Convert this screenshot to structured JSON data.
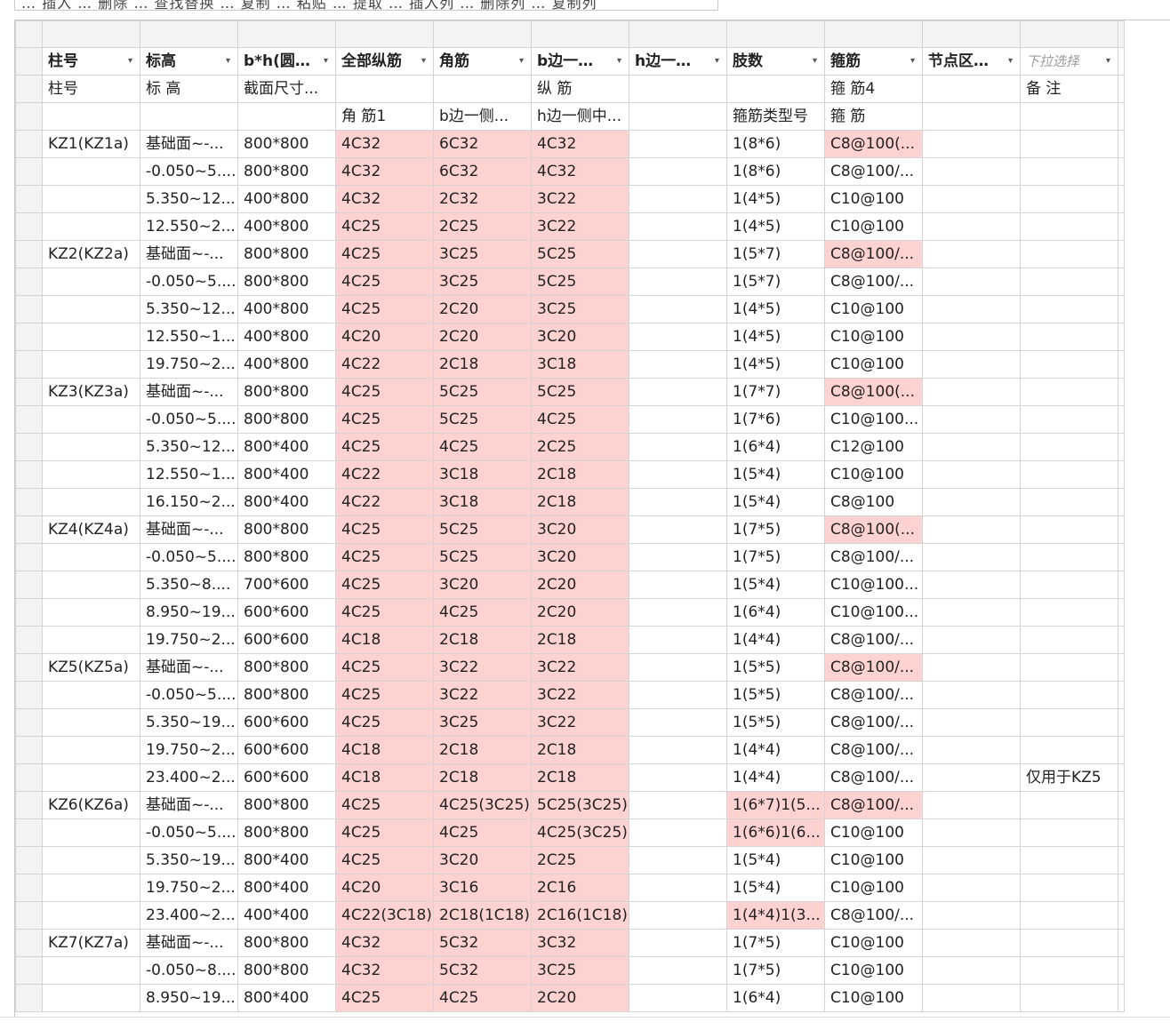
{
  "toolbar": {
    "partial_text": "… 插入 … 删除 … 查找替换 … 复制 … 粘贴 … 提取 … 插入列 … 删除列 … 复制列"
  },
  "columns": [
    {
      "header": "柱号",
      "dropdown": true
    },
    {
      "header": "标高",
      "dropdown": true
    },
    {
      "header": "b*h(圆…",
      "dropdown": true
    },
    {
      "header": "全部纵筋",
      "dropdown": true
    },
    {
      "header": "角筋",
      "dropdown": true
    },
    {
      "header": "b边一…",
      "dropdown": true
    },
    {
      "header": "h边一…",
      "dropdown": true
    },
    {
      "header": "肢数",
      "dropdown": true
    },
    {
      "header": "箍筋",
      "dropdown": true
    },
    {
      "header": "节点区…",
      "dropdown": true
    },
    {
      "header": "下拉选择",
      "dropdown": true,
      "placeholder": true
    }
  ],
  "subheader1": [
    "柱号",
    "标 高",
    "截面尺寸...",
    "",
    "",
    "纵 筋",
    "",
    "",
    "箍 筋4",
    "",
    "备 注"
  ],
  "subheader2": [
    "",
    "",
    "",
    "角 筋1",
    "b边一侧...",
    "h边一侧中...",
    "",
    "箍筋类型号",
    "箍 筋",
    "",
    ""
  ],
  "rows": [
    {
      "cells": [
        "KZ1(KZ1a)",
        "基础面~-...",
        "800*800",
        "4C32",
        "6C32",
        "4C32",
        "",
        "1(8*6)",
        "C8@100(...",
        "",
        ""
      ],
      "pink": [
        3,
        4,
        5,
        8
      ]
    },
    {
      "cells": [
        "",
        "-0.050~5....",
        "800*800",
        "4C32",
        "6C32",
        "4C32",
        "",
        "1(8*6)",
        "C8@100/...",
        "",
        ""
      ],
      "pink": [
        3,
        4,
        5
      ]
    },
    {
      "cells": [
        "",
        "5.350~12...",
        "400*800",
        "4C32",
        "2C32",
        "3C22",
        "",
        "1(4*5)",
        "C10@100",
        "",
        ""
      ],
      "pink": [
        3,
        4,
        5
      ]
    },
    {
      "cells": [
        "",
        "12.550~2...",
        "400*800",
        "4C25",
        "2C25",
        "3C22",
        "",
        "1(4*5)",
        "C10@100",
        "",
        ""
      ],
      "pink": [
        3,
        4,
        5
      ]
    },
    {
      "cells": [
        "KZ2(KZ2a)",
        "基础面~-...",
        "800*800",
        "4C25",
        "3C25",
        "5C25",
        "",
        "1(5*7)",
        "C8@100/...",
        "",
        ""
      ],
      "pink": [
        3,
        4,
        5,
        8
      ]
    },
    {
      "cells": [
        "",
        "-0.050~5....",
        "800*800",
        "4C25",
        "3C25",
        "5C25",
        "",
        "1(5*7)",
        "C8@100/...",
        "",
        ""
      ],
      "pink": [
        3,
        4,
        5
      ]
    },
    {
      "cells": [
        "",
        "5.350~12...",
        "400*800",
        "4C25",
        "2C20",
        "3C25",
        "",
        "1(4*5)",
        "C10@100",
        "",
        ""
      ],
      "pink": [
        3,
        4,
        5
      ]
    },
    {
      "cells": [
        "",
        "12.550~1...",
        "400*800",
        "4C20",
        "2C20",
        "3C20",
        "",
        "1(4*5)",
        "C10@100",
        "",
        ""
      ],
      "pink": [
        3,
        4,
        5
      ]
    },
    {
      "cells": [
        "",
        "19.750~2...",
        "400*800",
        "4C22",
        "2C18",
        "3C18",
        "",
        "1(4*5)",
        "C10@100",
        "",
        ""
      ],
      "pink": [
        3,
        4,
        5
      ]
    },
    {
      "cells": [
        "KZ3(KZ3a)",
        "基础面~-...",
        "800*800",
        "4C25",
        "5C25",
        "5C25",
        "",
        "1(7*7)",
        "C8@100(...",
        "",
        ""
      ],
      "pink": [
        3,
        4,
        5,
        8
      ]
    },
    {
      "cells": [
        "",
        "-0.050~5....",
        "800*800",
        "4C25",
        "5C25",
        "4C25",
        "",
        "1(7*6)",
        "C10@100...",
        "",
        ""
      ],
      "pink": [
        3,
        4,
        5
      ]
    },
    {
      "cells": [
        "",
        "5.350~12...",
        "800*400",
        "4C25",
        "4C25",
        "2C25",
        "",
        "1(6*4)",
        "C12@100",
        "",
        ""
      ],
      "pink": [
        3,
        4,
        5
      ]
    },
    {
      "cells": [
        "",
        "12.550~1...",
        "800*400",
        "4C22",
        "3C18",
        "2C18",
        "",
        "1(5*4)",
        "C10@100",
        "",
        ""
      ],
      "pink": [
        3,
        4,
        5
      ]
    },
    {
      "cells": [
        "",
        "16.150~2...",
        "800*400",
        "4C22",
        "3C18",
        "2C18",
        "",
        "1(5*4)",
        "C8@100",
        "",
        ""
      ],
      "pink": [
        3,
        4,
        5
      ]
    },
    {
      "cells": [
        "KZ4(KZ4a)",
        "基础面~-...",
        "800*800",
        "4C25",
        "5C25",
        "3C20",
        "",
        "1(7*5)",
        "C8@100(...",
        "",
        ""
      ],
      "pink": [
        3,
        4,
        5,
        8
      ]
    },
    {
      "cells": [
        "",
        "-0.050~5....",
        "800*800",
        "4C25",
        "5C25",
        "3C20",
        "",
        "1(7*5)",
        "C8@100/...",
        "",
        ""
      ],
      "pink": [
        3,
        4,
        5
      ]
    },
    {
      "cells": [
        "",
        "5.350~8....",
        "700*600",
        "4C25",
        "3C20",
        "2C20",
        "",
        "1(5*4)",
        "C10@100...",
        "",
        ""
      ],
      "pink": [
        3,
        4,
        5
      ]
    },
    {
      "cells": [
        "",
        "8.950~19...",
        "600*600",
        "4C25",
        "4C25",
        "2C20",
        "",
        "1(6*4)",
        "C10@100...",
        "",
        ""
      ],
      "pink": [
        3,
        4,
        5
      ]
    },
    {
      "cells": [
        "",
        "19.750~2...",
        "600*600",
        "4C18",
        "2C18",
        "2C18",
        "",
        "1(4*4)",
        "C8@100/...",
        "",
        ""
      ],
      "pink": [
        3,
        4,
        5
      ]
    },
    {
      "cells": [
        "KZ5(KZ5a)",
        "基础面~-...",
        "800*800",
        "4C25",
        "3C22",
        "3C22",
        "",
        "1(5*5)",
        "C8@100/...",
        "",
        ""
      ],
      "pink": [
        3,
        4,
        5,
        8
      ]
    },
    {
      "cells": [
        "",
        "-0.050~5....",
        "800*800",
        "4C25",
        "3C22",
        "3C22",
        "",
        "1(5*5)",
        "C8@100/...",
        "",
        ""
      ],
      "pink": [
        3,
        4,
        5
      ]
    },
    {
      "cells": [
        "",
        "5.350~19...",
        "600*600",
        "4C25",
        "3C25",
        "3C22",
        "",
        "1(5*5)",
        "C8@100/...",
        "",
        ""
      ],
      "pink": [
        3,
        4,
        5
      ]
    },
    {
      "cells": [
        "",
        "19.750~2...",
        "600*600",
        "4C18",
        "2C18",
        "2C18",
        "",
        "1(4*4)",
        "C8@100/...",
        "",
        ""
      ],
      "pink": [
        3,
        4,
        5
      ]
    },
    {
      "cells": [
        "",
        "23.400~2...",
        "600*600",
        "4C18",
        "2C18",
        "2C18",
        "",
        "1(4*4)",
        "C8@100/...",
        "",
        "仅用于KZ5"
      ],
      "pink": [
        3,
        4,
        5
      ]
    },
    {
      "cells": [
        "KZ6(KZ6a)",
        "基础面~-...",
        "800*800",
        "4C25",
        "4C25(3C25)",
        "5C25(3C25)",
        "",
        "1(6*7)1(5...",
        "C8@100/...",
        "",
        ""
      ],
      "pink": [
        3,
        4,
        5,
        7,
        8
      ]
    },
    {
      "cells": [
        "",
        "-0.050~5....",
        "800*800",
        "4C25",
        "4C25",
        "4C25(3C25)",
        "",
        "1(6*6)1(6...",
        "C10@100",
        "",
        ""
      ],
      "pink": [
        3,
        4,
        5,
        7
      ]
    },
    {
      "cells": [
        "",
        "5.350~19...",
        "800*400",
        "4C25",
        "3C20",
        "2C25",
        "",
        "1(5*4)",
        "C10@100",
        "",
        ""
      ],
      "pink": [
        3,
        4,
        5
      ]
    },
    {
      "cells": [
        "",
        "19.750~2...",
        "800*400",
        "4C20",
        "3C16",
        "2C16",
        "",
        "1(5*4)",
        "C10@100",
        "",
        ""
      ],
      "pink": [
        3,
        4,
        5
      ]
    },
    {
      "cells": [
        "",
        "23.400~2...",
        "400*400",
        "4C22(3C18)",
        "2C18(1C18)",
        "2C16(1C18)",
        "",
        "1(4*4)1(3...",
        "C8@100/...",
        "",
        ""
      ],
      "pink": [
        3,
        4,
        5,
        7
      ]
    },
    {
      "cells": [
        "KZ7(KZ7a)",
        "基础面~-...",
        "800*800",
        "4C32",
        "5C32",
        "3C32",
        "",
        "1(7*5)",
        "C10@100",
        "",
        ""
      ],
      "pink": [
        3,
        4,
        5
      ]
    },
    {
      "cells": [
        "",
        "-0.050~8....",
        "800*800",
        "4C32",
        "5C32",
        "3C25",
        "",
        "1(7*5)",
        "C10@100",
        "",
        ""
      ],
      "pink": [
        3,
        4,
        5
      ]
    },
    {
      "cells": [
        "",
        "8.950~19...",
        "800*400",
        "4C25",
        "4C25",
        "2C20",
        "",
        "1(6*4)",
        "C10@100",
        "",
        ""
      ],
      "pink": [
        3,
        4,
        5
      ]
    }
  ]
}
